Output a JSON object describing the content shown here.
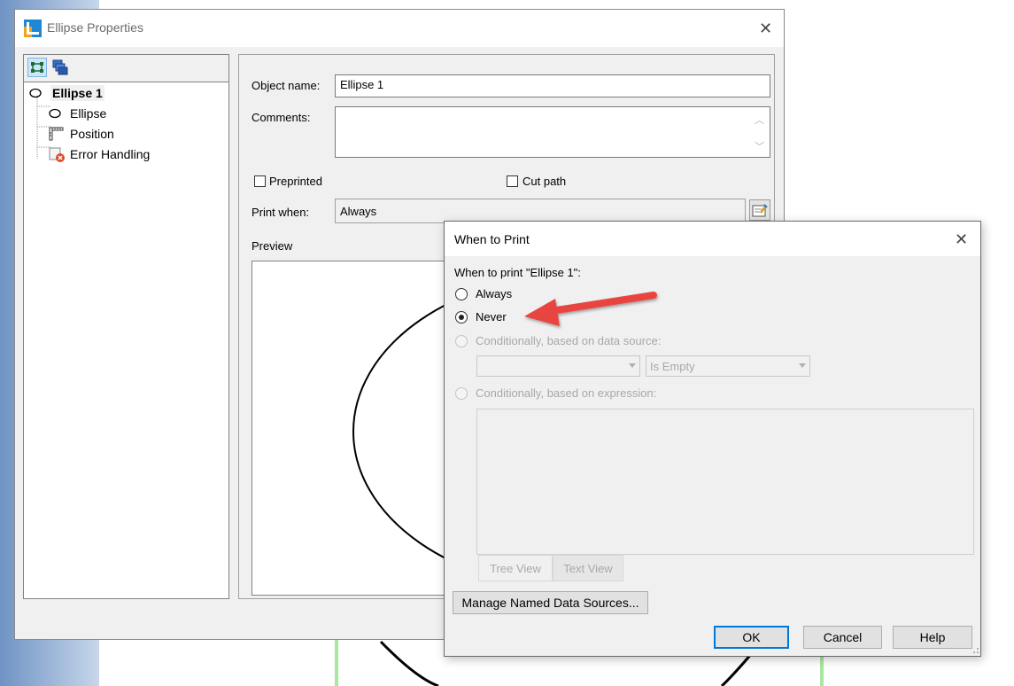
{
  "main_dialog": {
    "title": "Ellipse Properties",
    "tree": {
      "root": "Ellipse 1",
      "children": [
        "Ellipse",
        "Position",
        "Error Handling"
      ]
    },
    "object_name_label": "Object name:",
    "object_name_value": "Ellipse 1",
    "comments_label": "Comments:",
    "comments_value": "",
    "preprinted_label": "Preprinted",
    "cut_path_label": "Cut path",
    "print_when_label": "Print when:",
    "print_when_value": "Always",
    "preview_label": "Preview"
  },
  "when_to_print": {
    "title": "When to Print",
    "prompt": "When to print \"Ellipse 1\":",
    "options": {
      "always": "Always",
      "never": "Never",
      "conditional_data_source": "Conditionally, based on data source:",
      "conditional_expression": "Conditionally, based on expression:"
    },
    "selected": "never",
    "data_source_value": "",
    "condition_value": "Is Empty",
    "tabs": [
      "Tree View",
      "Text View"
    ],
    "manage_button": "Manage Named Data Sources...",
    "ok_button": "OK",
    "cancel_button": "Cancel",
    "help_button": "Help"
  },
  "colors": {
    "annotation_arrow": "#e8443f",
    "default_button_border": "#0078d7",
    "guide_line": "#a9e8a0"
  }
}
